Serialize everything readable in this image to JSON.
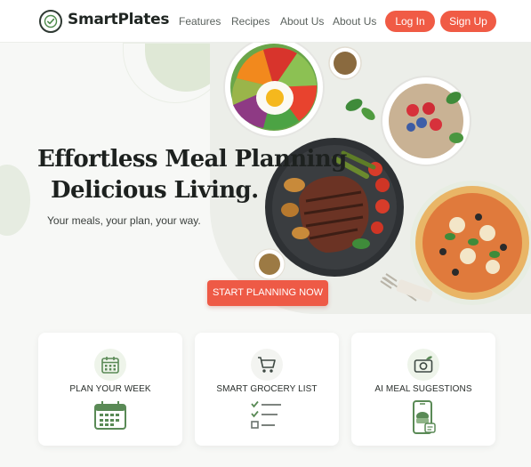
{
  "brand": {
    "name": "SmartPlates"
  },
  "nav": {
    "links": [
      "Features",
      "Recipes",
      "About Us",
      "About Us"
    ],
    "login_label": "Log In",
    "signup_label": "Sign Up"
  },
  "hero": {
    "headline_line1": "Effortless Meal Planning",
    "headline_line2": "Delicious Living.",
    "subline": "Your meals, your plan, your way.",
    "cta_label": "START PLANNING NOW"
  },
  "features": [
    {
      "title": "PLAN YOUR WEEK",
      "top_icon": "calendar-icon",
      "bottom_icon": "calendar-grid-icon"
    },
    {
      "title": "SMART GROCERY LIST",
      "top_icon": "shopping-cart-icon",
      "bottom_icon": "checklist-icon"
    },
    {
      "title": "AI MEAL SUGESTIONS",
      "top_icon": "camera-leaf-icon",
      "bottom_icon": "phone-meal-icon"
    }
  ],
  "colors": {
    "accent": "#f05b45",
    "green": "#5a8a56",
    "text_dark": "#1d211f"
  }
}
